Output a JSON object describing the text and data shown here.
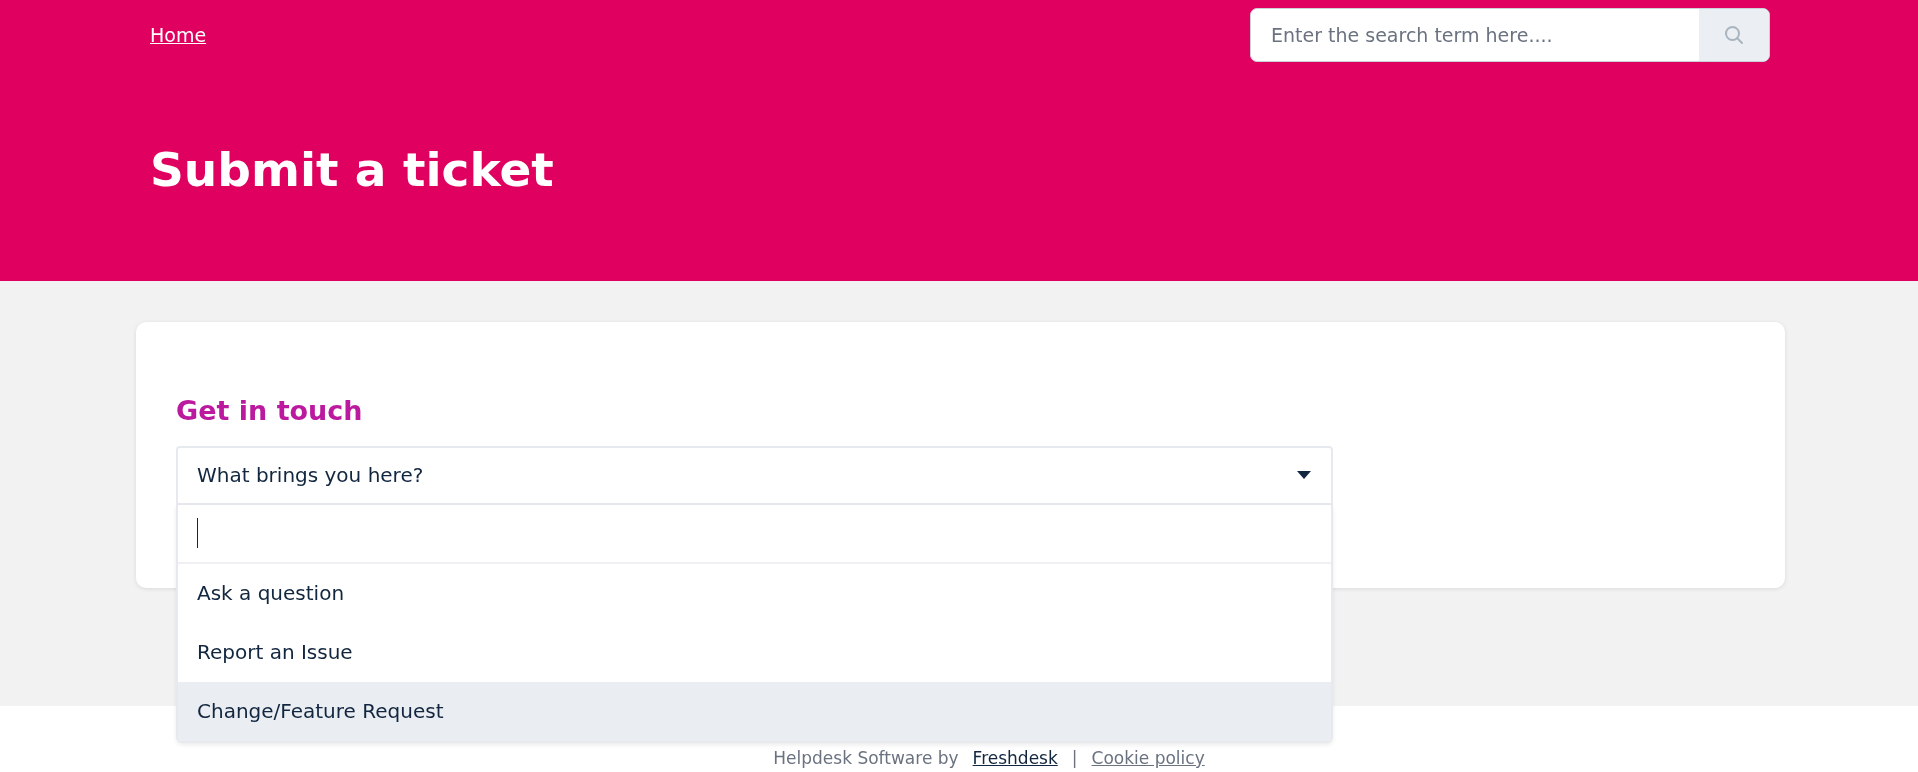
{
  "header": {
    "home_link": "Home",
    "search": {
      "placeholder": "Enter the search term here...."
    },
    "title": "Submit a ticket"
  },
  "form": {
    "heading": "Get in touch",
    "select": {
      "value": "What brings you here?",
      "expanded": true,
      "options": [
        {
          "label": "Ask a question",
          "selected": false
        },
        {
          "label": "Report an Issue",
          "selected": false
        },
        {
          "label": "Change/Feature Request",
          "selected": true
        }
      ]
    }
  },
  "footer": {
    "text": "Helpdesk Software by",
    "link": "Freshdesk",
    "separator": "|",
    "cookie_link": "Cookie policy"
  }
}
